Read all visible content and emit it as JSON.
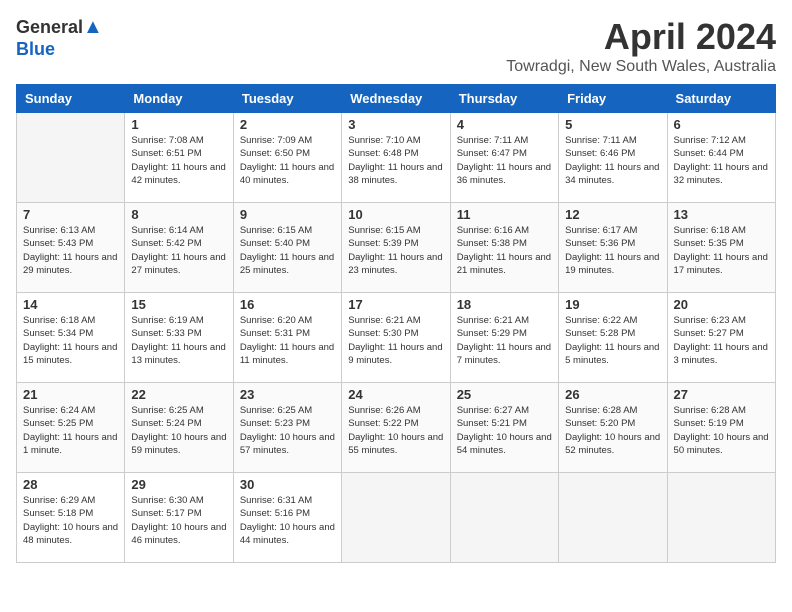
{
  "logo": {
    "general": "General",
    "blue": "Blue"
  },
  "title": "April 2024",
  "subtitle": "Towradgi, New South Wales, Australia",
  "days_of_week": [
    "Sunday",
    "Monday",
    "Tuesday",
    "Wednesday",
    "Thursday",
    "Friday",
    "Saturday"
  ],
  "weeks": [
    [
      {
        "day": "",
        "info": ""
      },
      {
        "day": "1",
        "info": "Sunrise: 7:08 AM\nSunset: 6:51 PM\nDaylight: 11 hours\nand 42 minutes."
      },
      {
        "day": "2",
        "info": "Sunrise: 7:09 AM\nSunset: 6:50 PM\nDaylight: 11 hours\nand 40 minutes."
      },
      {
        "day": "3",
        "info": "Sunrise: 7:10 AM\nSunset: 6:48 PM\nDaylight: 11 hours\nand 38 minutes."
      },
      {
        "day": "4",
        "info": "Sunrise: 7:11 AM\nSunset: 6:47 PM\nDaylight: 11 hours\nand 36 minutes."
      },
      {
        "day": "5",
        "info": "Sunrise: 7:11 AM\nSunset: 6:46 PM\nDaylight: 11 hours\nand 34 minutes."
      },
      {
        "day": "6",
        "info": "Sunrise: 7:12 AM\nSunset: 6:44 PM\nDaylight: 11 hours\nand 32 minutes."
      }
    ],
    [
      {
        "day": "7",
        "info": "Sunrise: 6:13 AM\nSunset: 5:43 PM\nDaylight: 11 hours\nand 29 minutes."
      },
      {
        "day": "8",
        "info": "Sunrise: 6:14 AM\nSunset: 5:42 PM\nDaylight: 11 hours\nand 27 minutes."
      },
      {
        "day": "9",
        "info": "Sunrise: 6:15 AM\nSunset: 5:40 PM\nDaylight: 11 hours\nand 25 minutes."
      },
      {
        "day": "10",
        "info": "Sunrise: 6:15 AM\nSunset: 5:39 PM\nDaylight: 11 hours\nand 23 minutes."
      },
      {
        "day": "11",
        "info": "Sunrise: 6:16 AM\nSunset: 5:38 PM\nDaylight: 11 hours\nand 21 minutes."
      },
      {
        "day": "12",
        "info": "Sunrise: 6:17 AM\nSunset: 5:36 PM\nDaylight: 11 hours\nand 19 minutes."
      },
      {
        "day": "13",
        "info": "Sunrise: 6:18 AM\nSunset: 5:35 PM\nDaylight: 11 hours\nand 17 minutes."
      }
    ],
    [
      {
        "day": "14",
        "info": "Sunrise: 6:18 AM\nSunset: 5:34 PM\nDaylight: 11 hours\nand 15 minutes."
      },
      {
        "day": "15",
        "info": "Sunrise: 6:19 AM\nSunset: 5:33 PM\nDaylight: 11 hours\nand 13 minutes."
      },
      {
        "day": "16",
        "info": "Sunrise: 6:20 AM\nSunset: 5:31 PM\nDaylight: 11 hours\nand 11 minutes."
      },
      {
        "day": "17",
        "info": "Sunrise: 6:21 AM\nSunset: 5:30 PM\nDaylight: 11 hours\nand 9 minutes."
      },
      {
        "day": "18",
        "info": "Sunrise: 6:21 AM\nSunset: 5:29 PM\nDaylight: 11 hours\nand 7 minutes."
      },
      {
        "day": "19",
        "info": "Sunrise: 6:22 AM\nSunset: 5:28 PM\nDaylight: 11 hours\nand 5 minutes."
      },
      {
        "day": "20",
        "info": "Sunrise: 6:23 AM\nSunset: 5:27 PM\nDaylight: 11 hours\nand 3 minutes."
      }
    ],
    [
      {
        "day": "21",
        "info": "Sunrise: 6:24 AM\nSunset: 5:25 PM\nDaylight: 11 hours\nand 1 minute."
      },
      {
        "day": "22",
        "info": "Sunrise: 6:25 AM\nSunset: 5:24 PM\nDaylight: 10 hours\nand 59 minutes."
      },
      {
        "day": "23",
        "info": "Sunrise: 6:25 AM\nSunset: 5:23 PM\nDaylight: 10 hours\nand 57 minutes."
      },
      {
        "day": "24",
        "info": "Sunrise: 6:26 AM\nSunset: 5:22 PM\nDaylight: 10 hours\nand 55 minutes."
      },
      {
        "day": "25",
        "info": "Sunrise: 6:27 AM\nSunset: 5:21 PM\nDaylight: 10 hours\nand 54 minutes."
      },
      {
        "day": "26",
        "info": "Sunrise: 6:28 AM\nSunset: 5:20 PM\nDaylight: 10 hours\nand 52 minutes."
      },
      {
        "day": "27",
        "info": "Sunrise: 6:28 AM\nSunset: 5:19 PM\nDaylight: 10 hours\nand 50 minutes."
      }
    ],
    [
      {
        "day": "28",
        "info": "Sunrise: 6:29 AM\nSunset: 5:18 PM\nDaylight: 10 hours\nand 48 minutes."
      },
      {
        "day": "29",
        "info": "Sunrise: 6:30 AM\nSunset: 5:17 PM\nDaylight: 10 hours\nand 46 minutes."
      },
      {
        "day": "30",
        "info": "Sunrise: 6:31 AM\nSunset: 5:16 PM\nDaylight: 10 hours\nand 44 minutes."
      },
      {
        "day": "",
        "info": ""
      },
      {
        "day": "",
        "info": ""
      },
      {
        "day": "",
        "info": ""
      },
      {
        "day": "",
        "info": ""
      }
    ]
  ]
}
